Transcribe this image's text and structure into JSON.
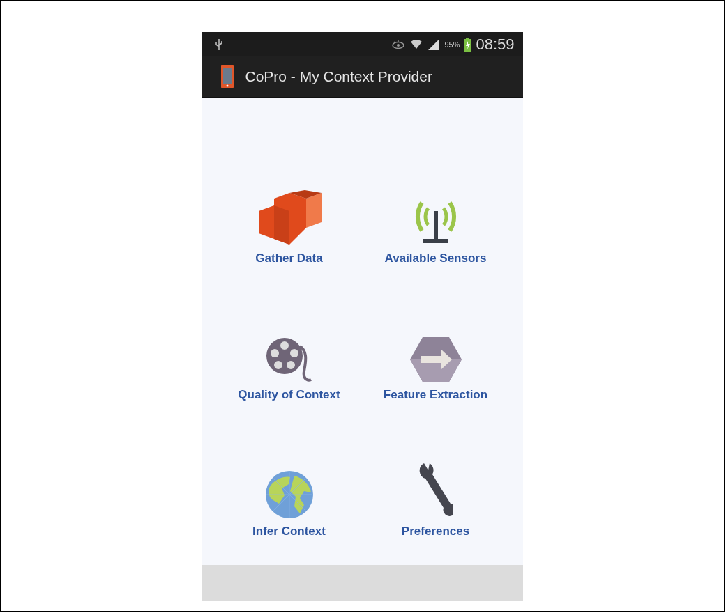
{
  "status_bar": {
    "battery": "95%",
    "time": "08:59"
  },
  "app_bar": {
    "title": "CoPro - My Context Provider"
  },
  "menu": [
    {
      "label": "Gather Data",
      "kind": "boxes"
    },
    {
      "label": "Available Sensors",
      "kind": "antenna"
    },
    {
      "label": "Quality of Context",
      "kind": "reel"
    },
    {
      "label": "Feature Extraction",
      "kind": "hexagon"
    },
    {
      "label": "Infer Context",
      "kind": "globe"
    },
    {
      "label": "Preferences",
      "kind": "wrench"
    }
  ]
}
